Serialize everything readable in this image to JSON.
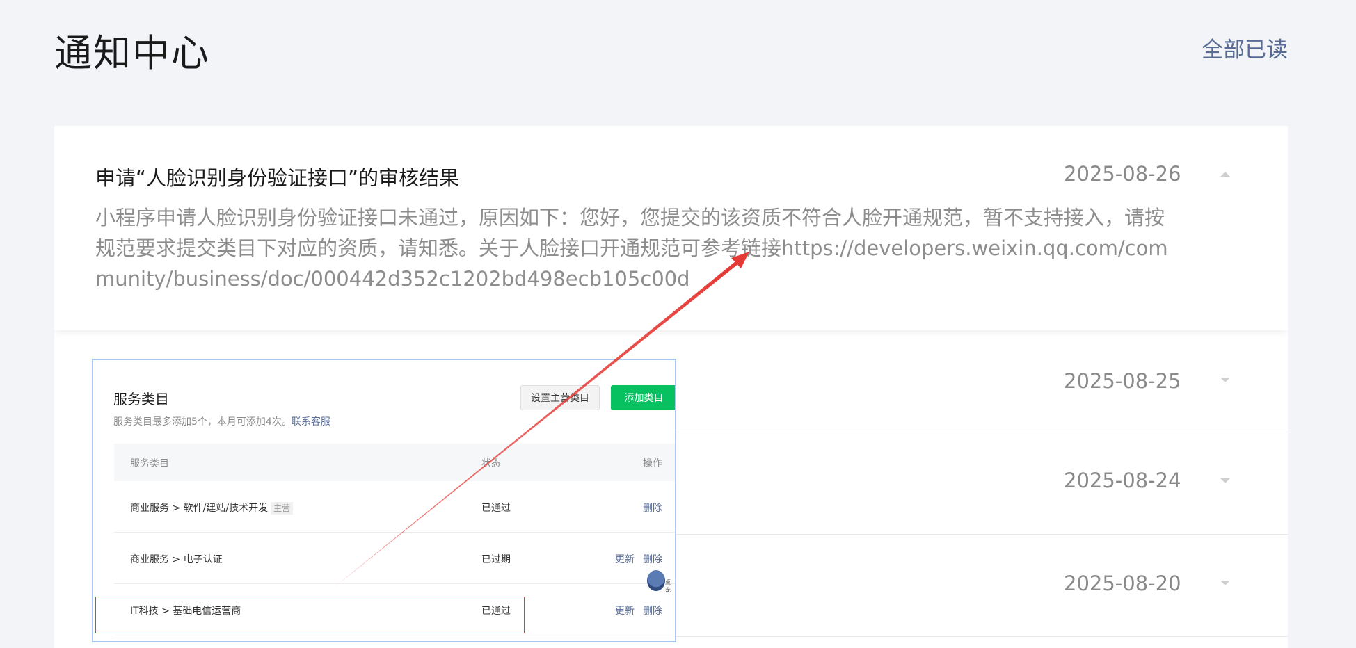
{
  "page": {
    "title": "通知中心",
    "mark_all_read": "全部已读"
  },
  "notifications": [
    {
      "title": "申请“人脸识别身份验证接口”的审核结果",
      "date": "2025-08-26",
      "body": "小程序申请人脸识别身份验证接口未通过，原因如下：您好，您提交的该资质不符合人脸开通规范，暂不支持接入，请按规范要求提交类目下对应的资质，请知悉。关于人脸接口开通规范可参考链接https://developers.weixin.qq.com/community/business/doc/000442d352c1202bd498ecb105c00d",
      "expanded": true
    },
    {
      "date": "2025-08-25",
      "expanded": false
    },
    {
      "date": "2025-08-24",
      "expanded": false
    },
    {
      "date": "2025-08-20",
      "expanded": false
    }
  ],
  "embedded_screenshot": {
    "title": "服务类目",
    "subtitle": "服务类目最多添加5个，本月可添加4次。",
    "contact_link": "联系客服",
    "set_primary_button": "设置主营类目",
    "add_button": "添加类目",
    "columns": [
      "服务类目",
      "状态",
      "操作"
    ],
    "rows": [
      {
        "category": "商业服务  >  软件/建站/技术开发",
        "tag": "主营",
        "status": "已通过",
        "actions": [
          "删除"
        ]
      },
      {
        "category": "商业服务  >  电子认证",
        "tag": "",
        "status": "已过期",
        "actions": [
          "更新",
          "删除"
        ]
      },
      {
        "category": "IT科技  >  基础电信运营商",
        "tag": "",
        "status": "已通过",
        "actions": [
          "更新",
          "删除"
        ]
      }
    ],
    "mascot_caption": "桌宠"
  },
  "colors": {
    "link": "#576b95",
    "primary_green": "#07c160",
    "annotation_red": "#e53935"
  }
}
